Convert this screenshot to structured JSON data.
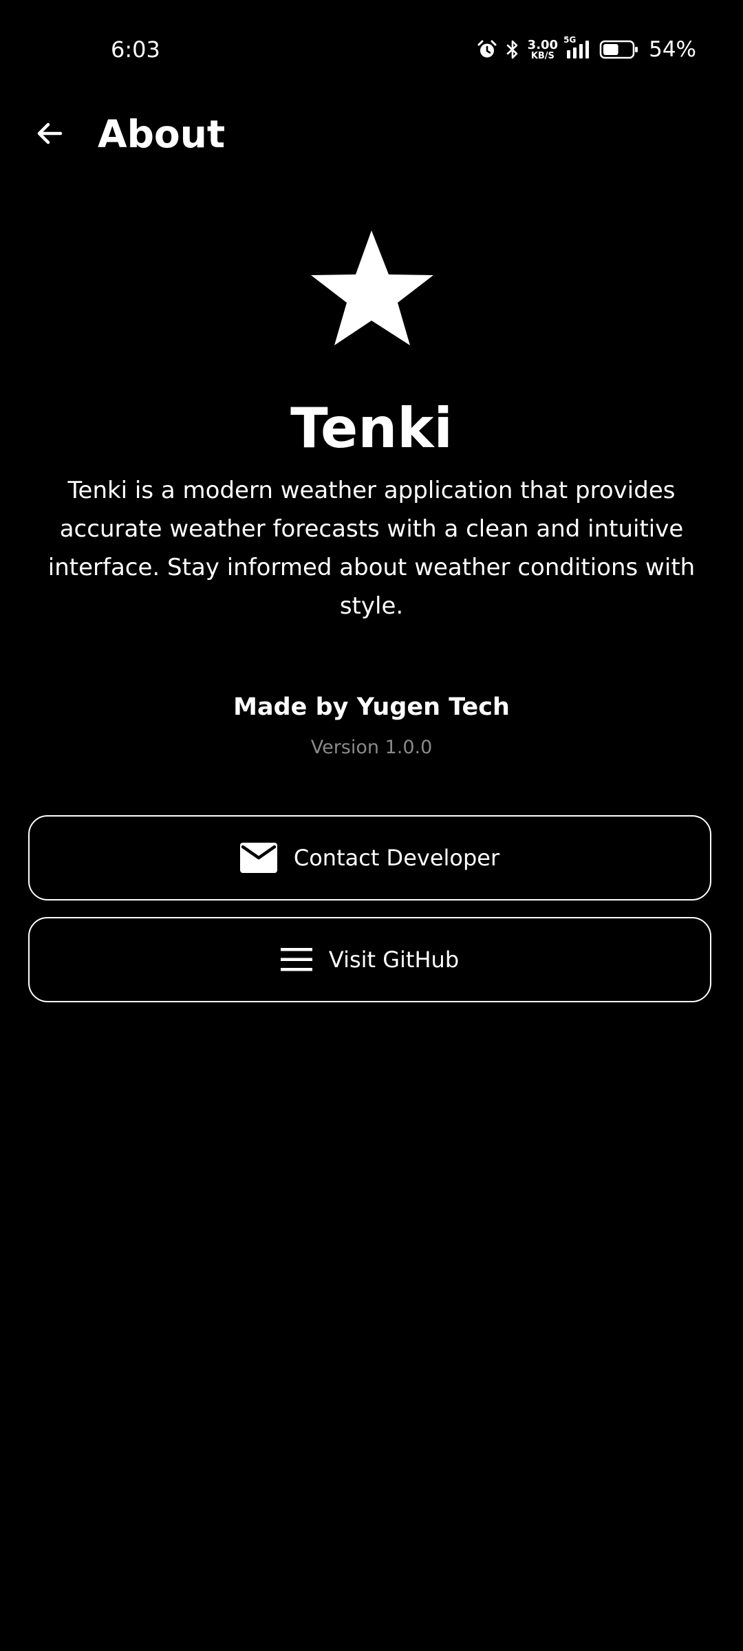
{
  "status_bar": {
    "time": "6:03",
    "net_speed_value": "3.00",
    "net_speed_unit": "KB/S",
    "network_type": "5G",
    "battery_percent": "54%",
    "battery_level": 0.54
  },
  "app_bar": {
    "title": "About",
    "back_icon": "arrow-back-icon"
  },
  "about": {
    "logo_icon": "star-icon",
    "app_name": "Tenki",
    "description": "Tenki is a modern weather application that provides accurate weather forecasts with a clean and intuitive interface. Stay informed about weather conditions with style.",
    "made_by": "Made by Yugen Tech",
    "version": "Version 1.0.0"
  },
  "actions": {
    "contact_label": "Contact Developer",
    "contact_icon": "mail-icon",
    "github_label": "Visit GitHub",
    "github_icon": "menu-icon"
  },
  "colors": {
    "background": "#000000",
    "foreground": "#ffffff",
    "muted_text": "#8a8a8a"
  }
}
